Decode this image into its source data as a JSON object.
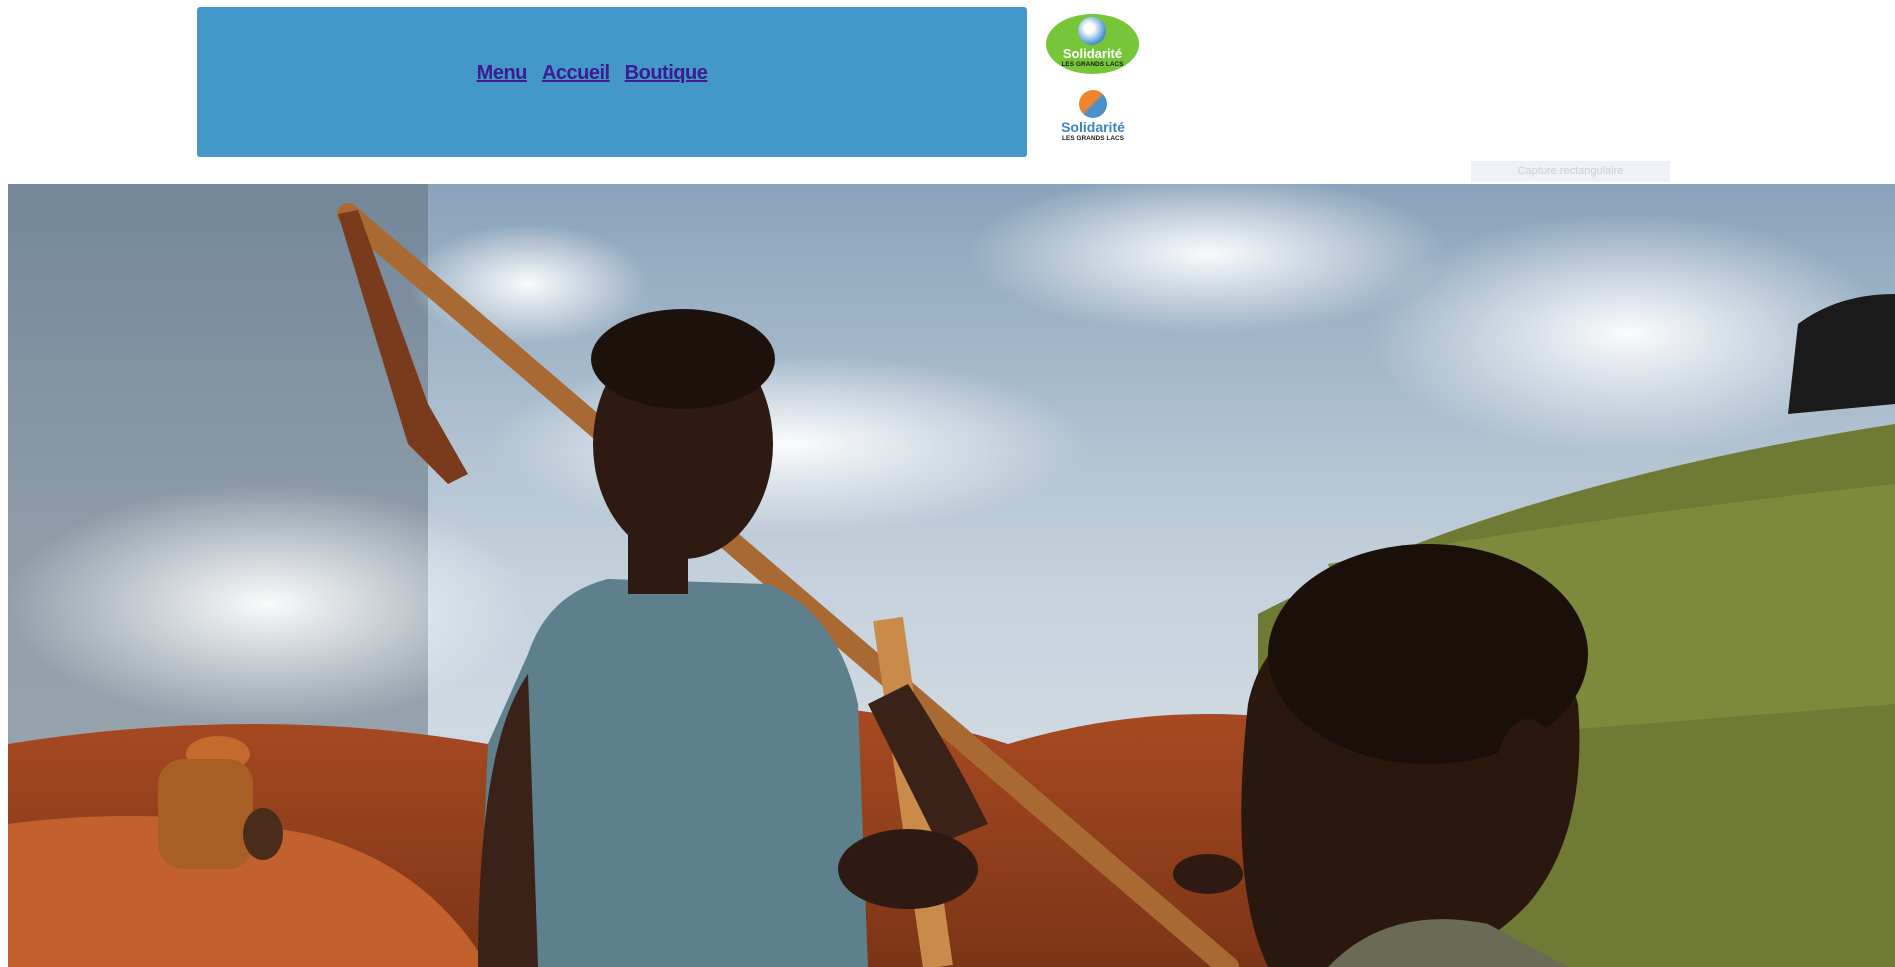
{
  "nav": {
    "links": [
      "Menu",
      "Accueil",
      "Boutique"
    ],
    "background_color": "#4397c9",
    "link_color": "#3c1c8f"
  },
  "logos": {
    "primary": {
      "name": "Solidarité",
      "subtitle": "LES GRANDS LACS",
      "background_color": "#77c63a"
    },
    "secondary": {
      "name": "Solidarité",
      "subtitle": "LES GRANDS LACS"
    }
  },
  "capture_chip": {
    "label": "Capture rectangulaire"
  },
  "hero_image": {
    "description_icon": "photo-image"
  }
}
